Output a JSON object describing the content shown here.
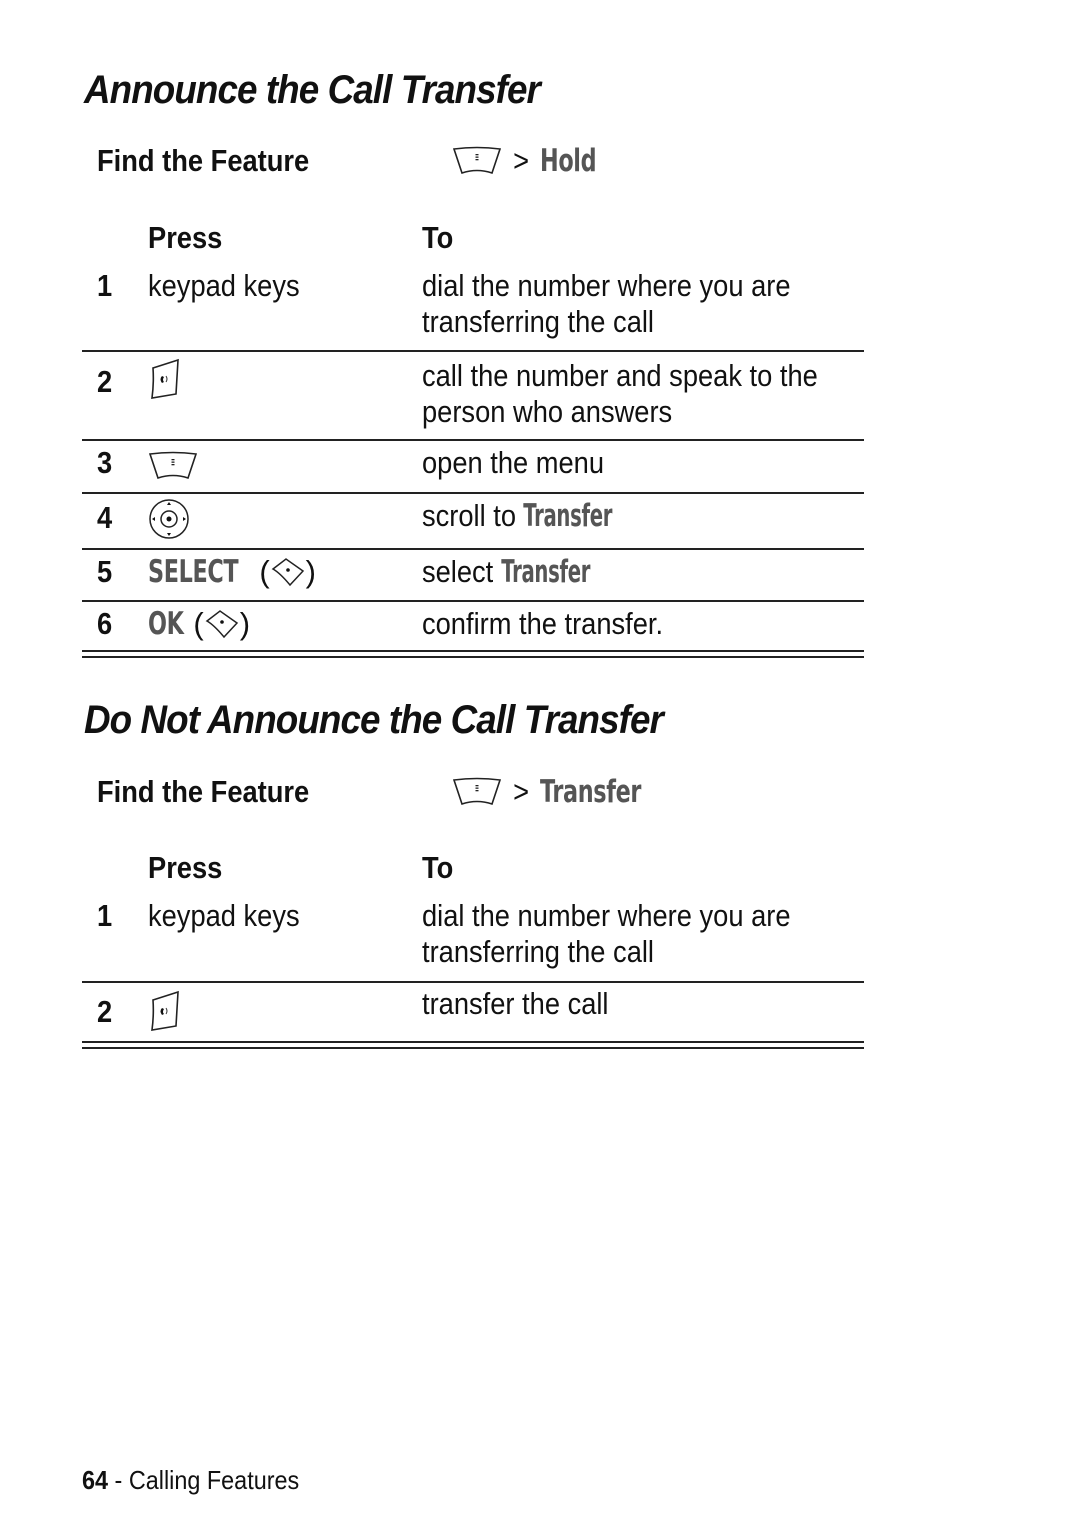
{
  "section1": {
    "title": "Announce the Call Transfer",
    "find_label": "Find the Feature",
    "path_separator": ">",
    "path_item": "Hold",
    "path_icon": "menu-key-icon",
    "header_press": "Press",
    "header_to": "To",
    "steps": [
      {
        "num": "1",
        "press": "keypad keys",
        "press_icon": "",
        "to": [
          "dial the number where you are",
          "transferring the call"
        ]
      },
      {
        "num": "2",
        "press": "",
        "press_icon": "send-key-icon",
        "to": [
          "call the number and speak to the",
          "person who answers"
        ]
      },
      {
        "num": "3",
        "press": "",
        "press_icon": "menu-key-icon",
        "to": [
          "open the menu"
        ]
      },
      {
        "num": "4",
        "press": "",
        "press_icon": "nav-key-icon",
        "to_prefix": "scroll to",
        "to_display": "Transfer"
      },
      {
        "num": "5",
        "press_display": "SELECT",
        "press_icon": "right-soft-key-icon",
        "to_prefix": "select",
        "to_display": "Transfer"
      },
      {
        "num": "6",
        "press_display": "OK",
        "press_icon": "right-soft-key-icon",
        "to": [
          "confirm the transfer."
        ]
      }
    ]
  },
  "section2": {
    "title": "Do Not Announce the Call Transfer",
    "find_label": "Find the Feature",
    "path_separator": ">",
    "path_item": "Transfer",
    "path_icon": "menu-key-icon",
    "header_press": "Press",
    "header_to": "To",
    "steps": [
      {
        "num": "1",
        "press": "keypad keys",
        "to": [
          "dial the number where you are",
          "transferring the call"
        ]
      },
      {
        "num": "2",
        "press": "",
        "press_icon": "send-key-icon",
        "to": [
          "transfer the call"
        ]
      }
    ]
  },
  "footer": {
    "page_number": "64",
    "separator": " - ",
    "section": "Calling Features"
  },
  "colors": {
    "text": "#111111",
    "display_text": "#555555",
    "rule": "#222222"
  }
}
